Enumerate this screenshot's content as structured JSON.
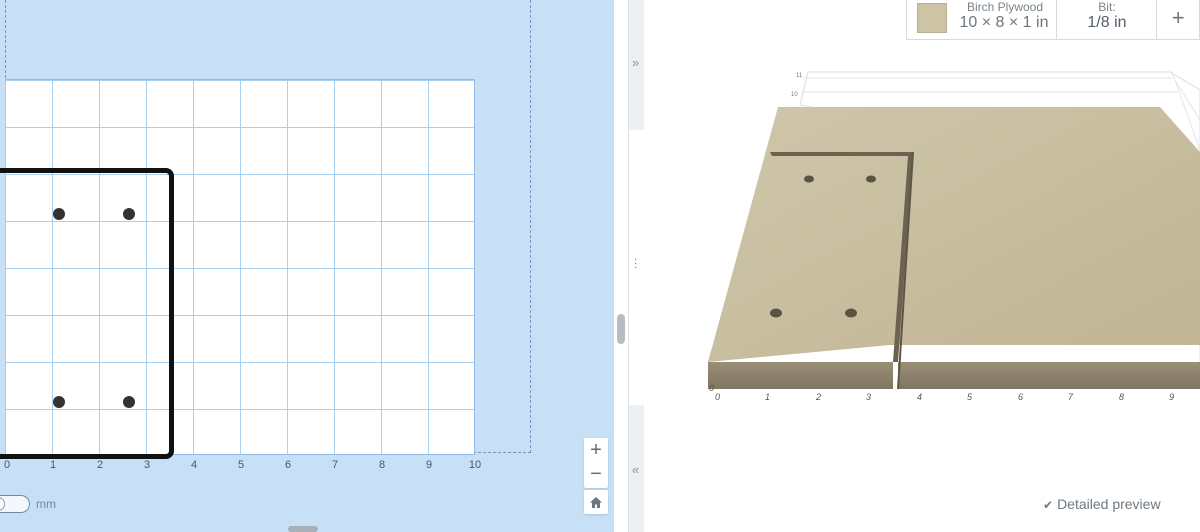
{
  "design": {
    "x_ticks": [
      "0",
      "1",
      "2",
      "3",
      "4",
      "5",
      "6",
      "7",
      "8",
      "9",
      "10"
    ],
    "holes_count": 4,
    "unit_toggle_label": "mm",
    "zoom_in_label": "+",
    "zoom_out_label": "−"
  },
  "panel": {
    "expand_right_icon": "»",
    "collapse_left_icon": "«",
    "drag_handle_icon": "⋮"
  },
  "toolbar": {
    "material_name": "Birch Plywood",
    "material_dims": "10 × 8 × 1 in",
    "bit_label": "Bit:",
    "bit_value": "1/8 in",
    "add_label": "+"
  },
  "preview": {
    "x_ticks": [
      "0",
      "1",
      "2",
      "3",
      "4",
      "5",
      "6",
      "7",
      "8",
      "9"
    ],
    "origin_label": "0",
    "z_ticks": [
      "11",
      "10"
    ],
    "detailed_preview_label": "Detailed preview"
  },
  "colors": {
    "canvas_bg": "#c8e0f6",
    "grid_line": "#a8cfee",
    "wood_top": "#c9bea2",
    "wood_side": "#8b806a"
  }
}
